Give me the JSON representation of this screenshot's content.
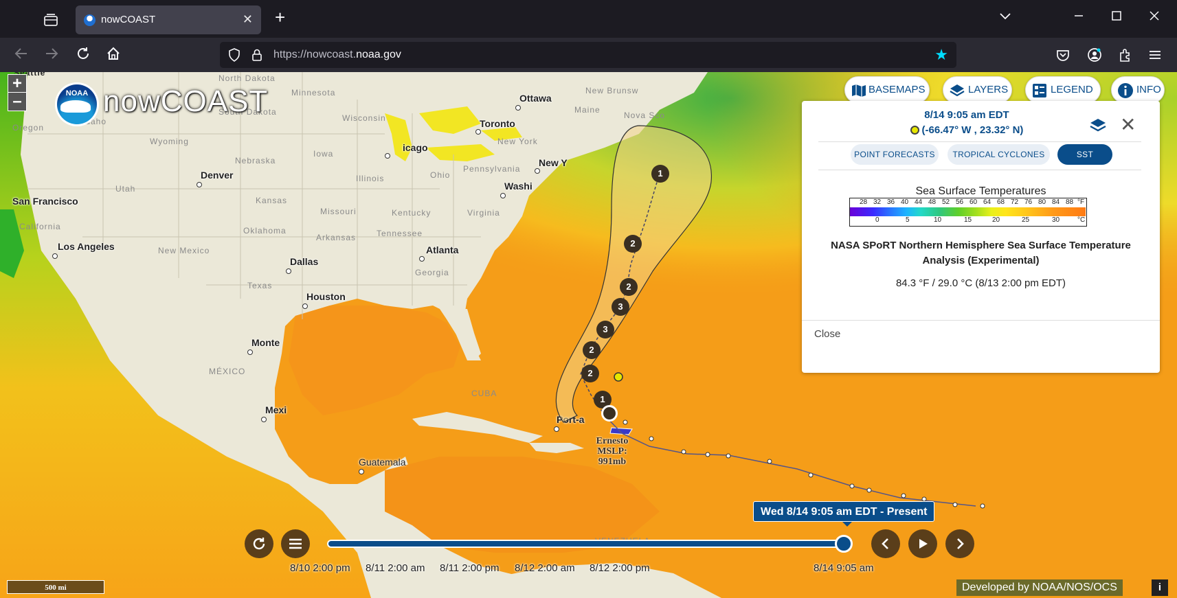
{
  "browser": {
    "tab_title": "nowCOAST",
    "tab_close": "✕",
    "new_tab": "+",
    "url_prefix": "https://nowcoast.",
    "url_domain": "noaa.gov",
    "window_controls": [
      "chevron-down",
      "minimize",
      "maximize",
      "close"
    ]
  },
  "map": {
    "brand": "nowCOAST",
    "logo_text": "NOAA",
    "zoom_in": "+",
    "zoom_out": "–",
    "buttons": {
      "basemaps": "BASEMAPS",
      "layers": "LAYERS",
      "legend": "LEGEND",
      "info": "INFO"
    },
    "region_labels": [
      "Seattle",
      "North Dakota",
      "Minnesota",
      "Oregon",
      "Idaho",
      "South Dakota",
      "Wisconsin",
      "Wyoming",
      "Iowa",
      "Nebraska",
      "Illinois",
      "Ohio",
      "Pennsylvania",
      "Utah",
      "Kansas",
      "Missouri",
      "Kentucky",
      "Virginia",
      "California",
      "Oklahoma",
      "Arkansas",
      "Tennessee",
      "New Mexico",
      "Georgia",
      "Texas",
      "MÉXICO",
      "CUBA",
      "New Brunsw",
      "Maine",
      "Nova Sco",
      "VENEZUELA"
    ],
    "cities": [
      {
        "name": "Ottawa"
      },
      {
        "name": "Toronto"
      },
      {
        "name": "New York"
      },
      {
        "name": "icago"
      },
      {
        "name": "Denver"
      },
      {
        "name": "San Francisco"
      },
      {
        "name": "Washi"
      },
      {
        "name": "New Y"
      },
      {
        "name": "Los Angeles"
      },
      {
        "name": "Dallas"
      },
      {
        "name": "Atlanta"
      },
      {
        "name": "Houston"
      },
      {
        "name": "Monte"
      },
      {
        "name": "Mexi"
      },
      {
        "name": "Port-a"
      },
      {
        "name": "Guatemala"
      }
    ],
    "storm": {
      "name": "Ernesto",
      "pressure_line1": "MSLP:",
      "pressure_line2": "991mb",
      "forecast_categories": [
        "1",
        "2",
        "2",
        "3",
        "3",
        "2",
        "2",
        "1"
      ]
    },
    "scale": "500 mi",
    "developed_by": "Developed by NOAA/NOS/OCS",
    "info_icon": "i"
  },
  "panel": {
    "time": "8/14 9:05 am EDT",
    "coordinates": "(-66.47° W , 23.32° N)",
    "tabs": [
      {
        "label": "POINT FORECASTS",
        "active": false
      },
      {
        "label": "TROPICAL CYCLONES",
        "active": false
      },
      {
        "label": "SST",
        "active": true
      }
    ],
    "legend_title": "Sea Surface Temperatures",
    "fahrenheit_ticks": [
      "28",
      "32",
      "36",
      "40",
      "44",
      "48",
      "52",
      "56",
      "60",
      "64",
      "68",
      "72",
      "76",
      "80",
      "84",
      "88",
      "°F"
    ],
    "celsius_ticks": [
      "0",
      "5",
      "10",
      "15",
      "20",
      "25",
      "30",
      "°C"
    ],
    "dataset_name": "NASA SPoRT Northern Hemisphere Sea Surface Temperature Analysis (Experimental)",
    "value": "84.3 °F / 29.0 °C (8/13 2:00 pm EDT)",
    "close_label": "Close"
  },
  "timeline": {
    "tooltip": "Wed 8/14 9:05 am EDT - Present",
    "ticks": [
      "8/10 2:00 pm",
      "8/11 2:00 am",
      "8/11 2:00 pm",
      "8/12 2:00 am",
      "8/12 2:00 pm",
      "8/14 9:05 am"
    ],
    "progress": 0.99
  },
  "colors": {
    "accent": "#0a4d8a",
    "ocean_warm": "#f59d18",
    "chrome_bg": "#1c1b22",
    "star": "#00ddff"
  }
}
